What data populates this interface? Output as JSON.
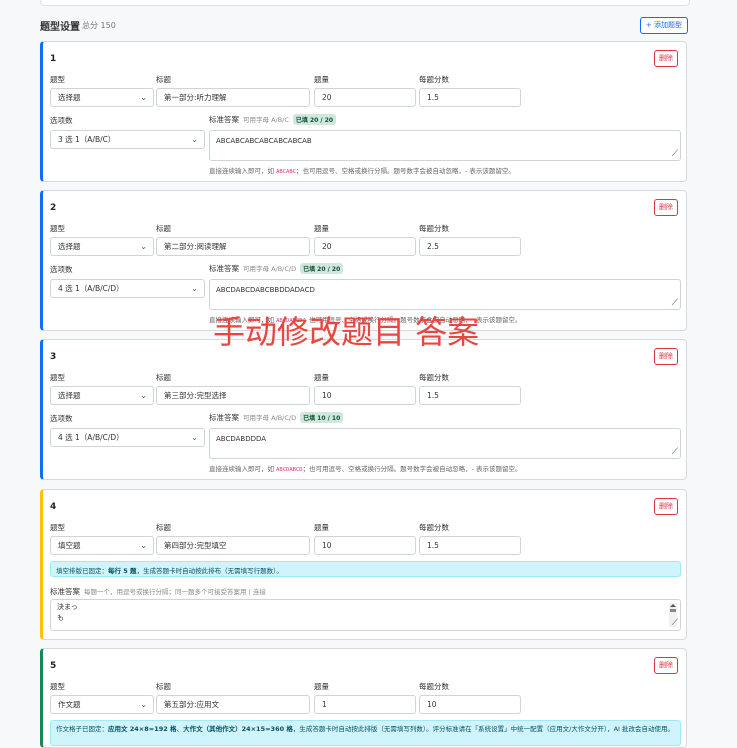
{
  "header": {
    "title": "题型设置",
    "total": "总分 150",
    "add_label": "+ 添加题型"
  },
  "labels": {
    "type": "题型",
    "title": "标题",
    "count": "题量",
    "score": "每题分数",
    "options": "选项数",
    "answer": "标准答案",
    "delete": "删除"
  },
  "questions": [
    {
      "num": "1",
      "type": "选择题",
      "title": "第一部分:听力理解",
      "count": "20",
      "score": "1.5",
      "options": "3 选 1（A/B/C）",
      "answer_hint": "可用字母 A/B/C",
      "badge": "已填 20 / 20",
      "answer": "ABCABCABCABCABCABCAB",
      "note_pre": "直接连续输入即可，如",
      "note_ex": "ABCABC",
      "note_post": "；也可用逗号、空格或换行分隔。题号数字会被自动忽略，- 表示该题留空。"
    },
    {
      "num": "2",
      "type": "选择题",
      "title": "第二部分:阅读理解",
      "count": "20",
      "score": "2.5",
      "options": "4 选 1（A/B/C/D）",
      "answer_hint": "可用字母 A/B/C/D",
      "badge": "已填 20 / 20",
      "answer": "ABCDABCDABCBBDDADACD",
      "note_pre": "直接连续输入即可，如",
      "note_ex": "ABCDABCD",
      "note_post": "；也可用逗号、空格或换行分隔。题号数字会被自动忽略，- 表示该题留空。"
    },
    {
      "num": "3",
      "type": "选择题",
      "title": "第三部分:完型选择",
      "count": "10",
      "score": "1.5",
      "options": "4 选 1（A/B/C/D）",
      "answer_hint": "可用字母 A/B/C/D",
      "badge": "已填 10 / 10",
      "answer": "ABCDABDDDA",
      "note_pre": "直接连续输入即可，如",
      "note_ex": "ABCDABCD",
      "note_post": "；也可用逗号、空格或换行分隔。题号数字会被自动忽略，- 表示该题留空。"
    },
    {
      "num": "4",
      "type": "填空题",
      "title": "第四部分:完型填空",
      "count": "10",
      "score": "1.5",
      "info_pre": "填空排版已固定：",
      "info_bold": "每行 5 题",
      "info_post": "，生成答题卡时自动按此排布（无需填写行题数）。",
      "answer_label": "标准答案",
      "answer_hint": "每题一个，用逗号或换行分隔；同一题多个可接受答案用 | 连接",
      "answer_lines": [
        "決まっ",
        "も"
      ]
    },
    {
      "num": "5",
      "type": "作文题",
      "title": "第五部分:应用文",
      "count": "1",
      "score": "10",
      "info_pre": "作文格子已固定：",
      "info_bold1": "应用文 24×8=192 格",
      "info_mid": "、",
      "info_bold2": "大作文（其他作文）24×15=360 格",
      "info_post": "，生成答题卡时自动按此排版（无需填写列数）。评分标准请在「系统设置」中统一配置（应用文/大作文分开），AI 批改会自动使用。"
    }
  ],
  "overlay_text": "手动修改题目 答案"
}
